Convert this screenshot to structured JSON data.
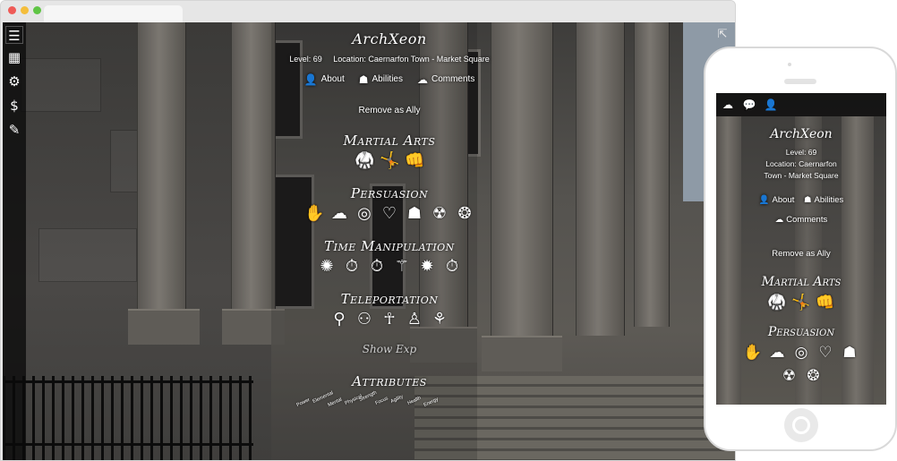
{
  "profile": {
    "username": "ArchXeon",
    "level": "Level: 69",
    "location": "Location: Caernarfon Town - Market Square",
    "tabs": [
      {
        "label": "About",
        "icon": "person-icon"
      },
      {
        "label": "Abilities",
        "icon": "head-icon"
      },
      {
        "label": "Comments",
        "icon": "speech-icon"
      }
    ],
    "ally_action": "Remove as Ally",
    "show_exp": "Show Exp"
  },
  "sidebar": {
    "items": [
      {
        "icon": "menu-icon",
        "glyph": "☰"
      },
      {
        "icon": "map-icon",
        "glyph": "▦"
      },
      {
        "icon": "gear-icon",
        "glyph": "⚙"
      },
      {
        "icon": "dollar-icon",
        "glyph": "$"
      },
      {
        "icon": "wand-icon",
        "glyph": "✎"
      }
    ],
    "exit_glyph": "⇱"
  },
  "sections": {
    "martial_arts": {
      "title": "Martial Arts",
      "abilities": [
        {
          "icon": "kick-icon",
          "glyph": "🥋"
        },
        {
          "icon": "flying-kick-icon",
          "glyph": "🤸"
        },
        {
          "icon": "punch-icon",
          "glyph": "👊"
        }
      ]
    },
    "persuasion": {
      "title": "Persuasion",
      "abilities": [
        {
          "icon": "wave-hand-icon",
          "glyph": "✋"
        },
        {
          "icon": "speech-head-icon",
          "glyph": "☁"
        },
        {
          "icon": "spiral-head-icon",
          "glyph": "◎"
        },
        {
          "icon": "heart-head-icon",
          "glyph": "♡"
        },
        {
          "icon": "mask-head-icon",
          "glyph": "☗"
        },
        {
          "icon": "bio-head-icon",
          "glyph": "☢"
        },
        {
          "icon": "swirl-head-icon",
          "glyph": "❂"
        }
      ]
    },
    "time_manipulation": {
      "title": "Time Manipulation",
      "abilities": [
        {
          "icon": "vortex-icon",
          "glyph": "✺"
        },
        {
          "icon": "stopwatch-rewind-icon",
          "glyph": "⏱"
        },
        {
          "icon": "stopwatch-forward-icon",
          "glyph": "⏱"
        },
        {
          "icon": "time-figure-icon",
          "glyph": "⚚"
        },
        {
          "icon": "galaxy-icon",
          "glyph": "✹"
        },
        {
          "icon": "stopwatch-icon",
          "glyph": "⏱"
        }
      ]
    },
    "teleportation": {
      "title": "Teleportation",
      "abilities": [
        {
          "icon": "blink-figure-icon",
          "glyph": "⚲"
        },
        {
          "icon": "double-figure-icon",
          "glyph": "⚇"
        },
        {
          "icon": "phase-figure-icon",
          "glyph": "☥"
        },
        {
          "icon": "standing-figure-icon",
          "glyph": "♙"
        },
        {
          "icon": "portal-figure-icon",
          "glyph": "⚘"
        }
      ]
    },
    "attributes": {
      "title": "Attributes",
      "labels": [
        "Power",
        "Elemental",
        "Mental",
        "Physical",
        "Strength",
        "Focus",
        "Agility",
        "Health",
        "Energy"
      ]
    }
  },
  "mobile": {
    "username": "ArchXeon",
    "level": "Level: 69",
    "location_line1": "Location: Caernarfon",
    "location_line2": "Town - Market Square",
    "tabs": [
      {
        "label": "About"
      },
      {
        "label": "Abilities"
      },
      {
        "label": "Comments"
      }
    ],
    "ally_action": "Remove as Ally",
    "martial_title": "Martial Arts",
    "persuasion_title": "Persuasion",
    "topbar": [
      {
        "icon": "brain-icon",
        "glyph": "☁"
      },
      {
        "icon": "chat-icon",
        "glyph": "💬"
      },
      {
        "icon": "person-icon",
        "glyph": "👤"
      }
    ]
  },
  "colors": {
    "text": "#ffffff",
    "sidebar_bg": "#0a0a0a",
    "muted_text": "#cfcfcf"
  }
}
